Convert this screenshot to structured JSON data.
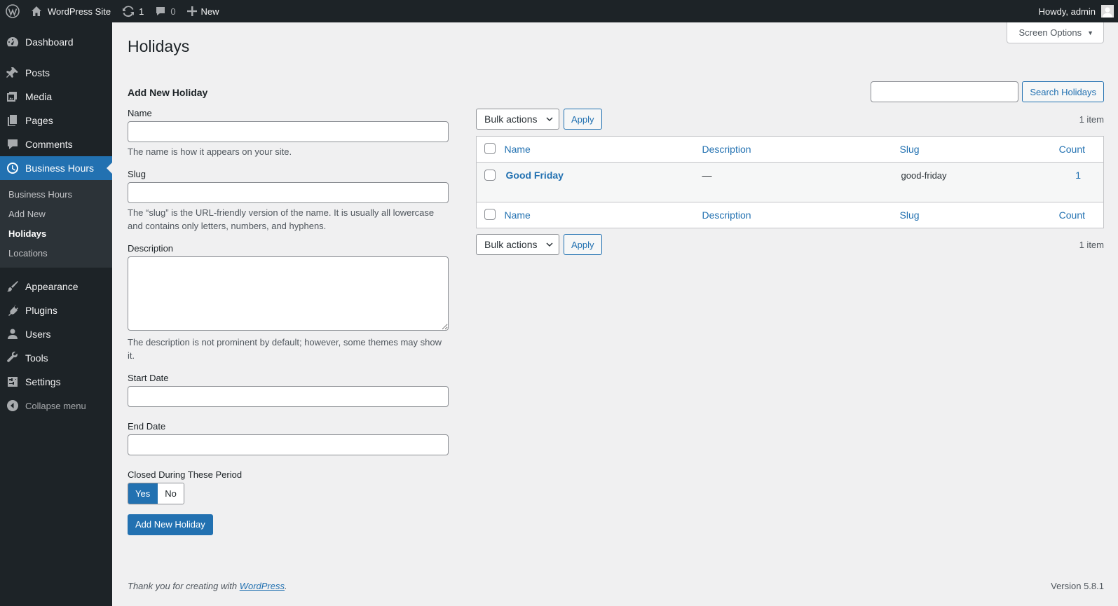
{
  "adminbar": {
    "site_name": "WordPress Site",
    "updates_count": "1",
    "comments_count": "0",
    "new_label": "New",
    "howdy": "Howdy, admin"
  },
  "sidebar": {
    "items": [
      {
        "label": "Dashboard",
        "icon": "dashboard-icon"
      },
      {
        "label": "Posts",
        "icon": "pin-icon"
      },
      {
        "label": "Media",
        "icon": "media-icon"
      },
      {
        "label": "Pages",
        "icon": "pages-icon"
      },
      {
        "label": "Comments",
        "icon": "comment-icon"
      },
      {
        "label": "Business Hours",
        "icon": "clock-icon"
      },
      {
        "label": "Appearance",
        "icon": "brush-icon"
      },
      {
        "label": "Plugins",
        "icon": "plug-icon"
      },
      {
        "label": "Users",
        "icon": "user-icon"
      },
      {
        "label": "Tools",
        "icon": "wrench-icon"
      },
      {
        "label": "Settings",
        "icon": "settings-icon"
      }
    ],
    "submenu": [
      "Business Hours",
      "Add New",
      "Holidays",
      "Locations"
    ],
    "collapse_label": "Collapse menu"
  },
  "screen_options": "Screen Options",
  "page_title": "Holidays",
  "form": {
    "heading": "Add New Holiday",
    "name_label": "Name",
    "name_desc": "The name is how it appears on your site.",
    "slug_label": "Slug",
    "slug_desc": "The “slug” is the URL-friendly version of the name. It is usually all lowercase and contains only letters, numbers, and hyphens.",
    "description_label": "Description",
    "description_desc": "The description is not prominent by default; however, some themes may show it.",
    "start_date_label": "Start Date",
    "end_date_label": "End Date",
    "closed_label": "Closed During These Period",
    "yes_label": "Yes",
    "no_label": "No",
    "submit_label": "Add New Holiday"
  },
  "list": {
    "search_button": "Search Holidays",
    "bulk_actions": "Bulk actions",
    "apply": "Apply",
    "items_count": "1 item",
    "columns": {
      "name": "Name",
      "description": "Description",
      "slug": "Slug",
      "count": "Count"
    },
    "rows": [
      {
        "name": "Good Friday",
        "description": "—",
        "slug": "good-friday",
        "count": "1"
      }
    ]
  },
  "footer": {
    "thanks_prefix": "Thank you for creating with ",
    "thanks_link": "WordPress",
    "thanks_suffix": ".",
    "version": "Version 5.8.1"
  },
  "colors": {
    "accent": "#2271b1",
    "admin_dark": "#1d2327"
  }
}
